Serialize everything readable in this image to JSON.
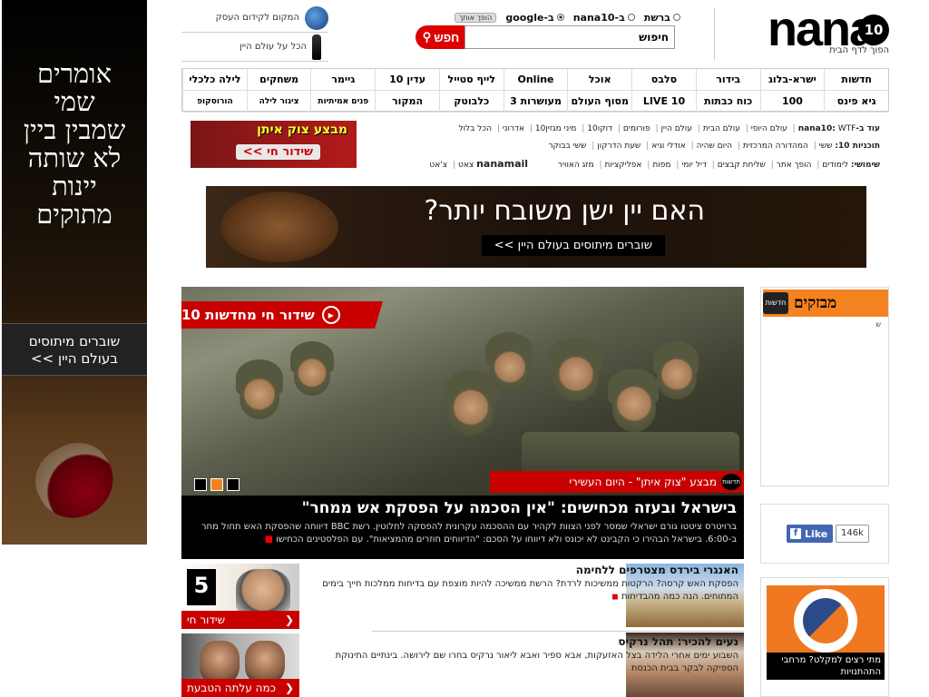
{
  "left_ad": {
    "headline_lines": [
      "אומרים",
      "שמי",
      "שמבין ביין",
      "לא שותה",
      "יינות",
      "מתוקים"
    ],
    "band_lines": [
      "שוברים מיתוסים",
      "בעולם היין >>"
    ]
  },
  "header": {
    "logo_text": "nana",
    "logo_badge": "10",
    "tagline": "הפוך לדף הבית",
    "search": {
      "radio_web": "ברשת",
      "radio_nana": "ב-nana10",
      "radio_google": "ב-google",
      "extra_badge": "הופך אותך",
      "selected": "google",
      "input_value": "חיפוש",
      "button_label": "חפש"
    },
    "promo": {
      "row1": "המקום לקידום העסק",
      "row2": "הכל על עולם היין"
    }
  },
  "nav": {
    "row1": [
      "חדשות",
      "ישרא-בלוג",
      "בידור",
      "סלבס",
      "אוכל",
      "Online",
      "לייף סטייל",
      "עדין 10",
      "גיימר",
      "משחקים",
      "לילה כלכלי"
    ],
    "row2": [
      "גיא פינס",
      "100",
      "כוח כבתות",
      "LIVE 10",
      "מסוף העולם",
      "מעושרות 3",
      "כלבוטק",
      "המקור",
      "פנים אמיתיות",
      "ציגור לילה",
      "הורוסקופ"
    ]
  },
  "more_links": {
    "label1": "עוד ב-nana10:",
    "links1": [
      "WTF",
      "עולם היופי",
      "עולם הבית",
      "עולם היין",
      "פורומים",
      "דוקו10",
      "מיני מגזין10",
      "אדרוני",
      "הכל בלול"
    ],
    "label2": "תוכניות 10:",
    "links2": [
      "ששי",
      "המהדורה המרכזית",
      "היום שהיה",
      "אודלי וגיא",
      "שעת הדרקון",
      "ששי בבוקר"
    ],
    "label3": "שימושי:",
    "links3": [
      "לימודים",
      "הופך אתר",
      "שליחת קבצים",
      "דיל יומי",
      "מפות",
      "אפליקציות",
      "מזג האוויר",
      "צאט",
      "צ'אט"
    ],
    "nanamail": "nanamail"
  },
  "live_banner": {
    "title": "מבצע צוק איתן",
    "button": "שידור חי >>"
  },
  "wide_ad": {
    "headline": "האם יין ישן משובח יותר?",
    "sub": "שוברים מיתוסים בעולם היין >>"
  },
  "hero": {
    "live_label": "שידור חי מחדשות 10",
    "op_label": "מבצע \"צוק איתן\" - היום העשירי",
    "op_logo": "חדשות",
    "headline": "בישראל ובעזה מכחישים: \"אין הסכמה על הפסקת אש ממחר\"",
    "body": "ברויטרס ציטטו גורם ישראלי שמסר לפני הצוות לקהיר עם ההסכמה עקרונית להפסקה לחלוטין. רשת BBC דיווחה שהפסקת האש תחול מחר ב-6:00. בישראל הבהירו כי הקבינט לא יכונס ולא דיווחו על הסכם: \"הדיווחים חוזרים מהמציאות\". עם הפלסטינים הכחישו",
    "slide_count": 3,
    "active_slide": 2
  },
  "stories": [
    {
      "title": "האנגרי בירדס מצטרפים ללחימה",
      "body": "הפסקת האש קרסה? הרקטות ממשיכות לרדת? הרשת ממשיכה להיות מוצפת עם בדיחות ממלכות חייך בימים המתוחים. הנה כמה מהבדיחות"
    },
    {
      "title": "נעים להכיר: תהל נרקיס",
      "body": "השבוע ימים אחרי הלידה בצל האזעקות, אבא ספיר ואבא ליאור נרקיס בחרו שם לירושה. בינתיים התינוקת הספיקה לבקר בבית הכנסת"
    }
  ],
  "mini": {
    "box1_label": "שידור חי",
    "box1_logo": "5",
    "box2_label": "כמה עלתה הטבעת"
  },
  "breaking": {
    "title": "מבזקים",
    "logo": "חדשות",
    "mark": "ש"
  },
  "facebook": {
    "like_label": "Like",
    "count": "146k"
  },
  "tzav": {
    "caption": "מתי רצים למקלט? מרחבי התהתנויות"
  }
}
